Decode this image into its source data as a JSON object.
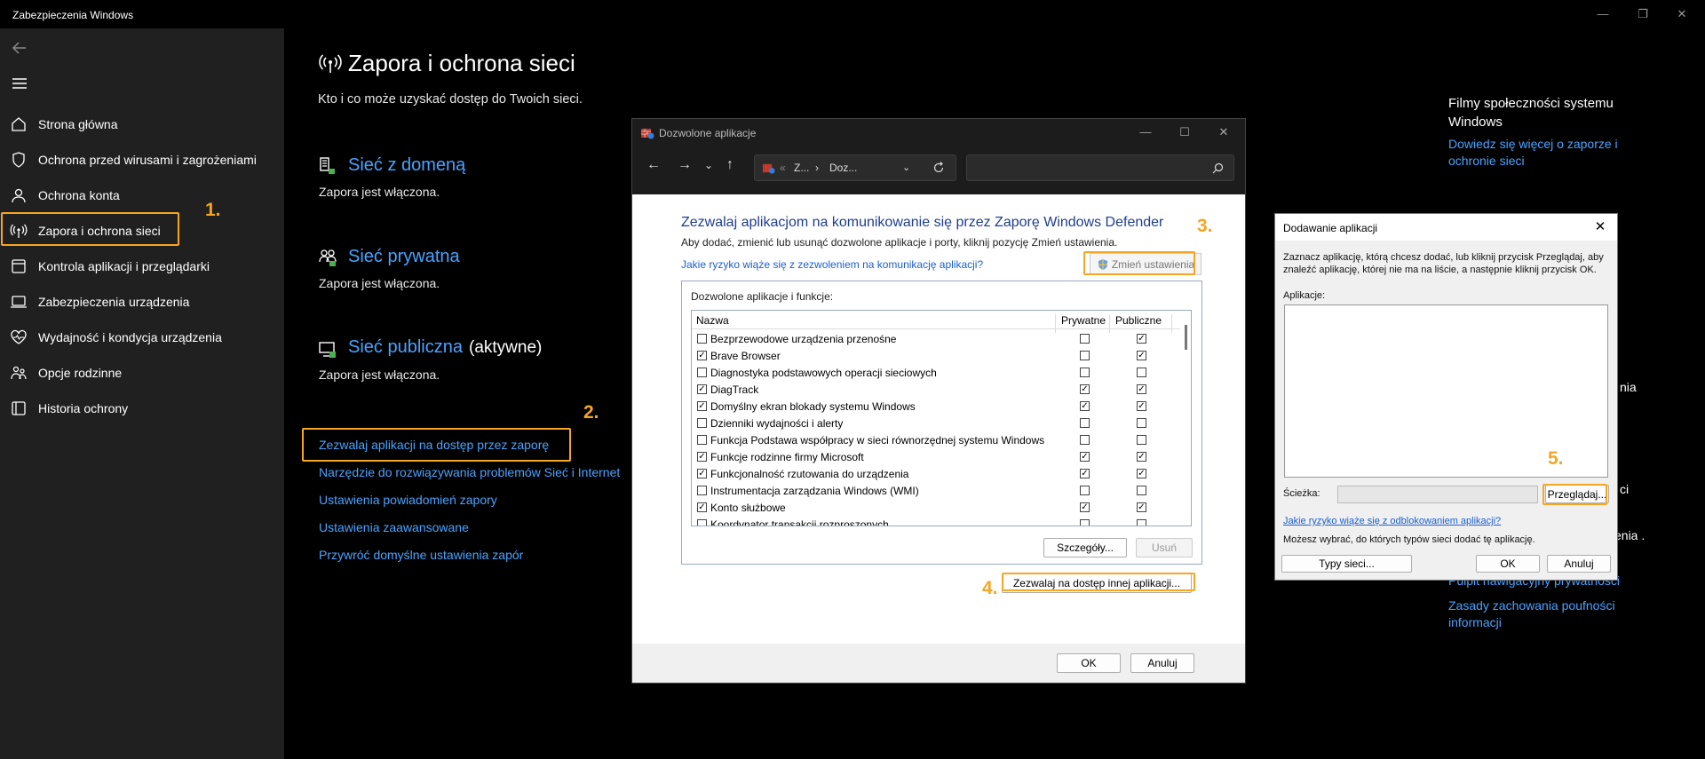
{
  "window": {
    "title": "Zabezpieczenia Windows",
    "controls": {
      "minimize": "—",
      "maximize": "❐",
      "close": "✕"
    }
  },
  "sidebar": {
    "items": [
      {
        "label": "Strona główna",
        "icon": "home-icon"
      },
      {
        "label": "Ochrona przed wirusami i zagrożeniami",
        "icon": "shield-icon"
      },
      {
        "label": "Ochrona konta",
        "icon": "person-icon"
      },
      {
        "label": "Zapora i ochrona sieci",
        "icon": "antenna-icon"
      },
      {
        "label": "Kontrola aplikacji i przeglądarki",
        "icon": "browser-window-icon"
      },
      {
        "label": "Zabezpieczenia urządzenia",
        "icon": "laptop-icon"
      },
      {
        "label": "Wydajność i kondycja urządzenia",
        "icon": "heart-pulse-icon"
      },
      {
        "label": "Opcje rodzinne",
        "icon": "family-icon"
      },
      {
        "label": "Historia ochrony",
        "icon": "history-icon"
      }
    ]
  },
  "steps": {
    "s1": "1.",
    "s2": "2.",
    "s3": "3.",
    "s4": "4.",
    "s5": "5."
  },
  "main": {
    "title": "Zapora i ochrona sieci",
    "subtitle": "Kto i co może uzyskać dostęp do Twoich sieci.",
    "networks": [
      {
        "title": "Sieć z domeną",
        "status": "Zapora jest włączona."
      },
      {
        "title": "Sieć prywatna",
        "status": "Zapora jest włączona."
      },
      {
        "title": "Sieć publiczna",
        "active": "(aktywne)",
        "status": "Zapora jest włączona."
      }
    ],
    "links": [
      "Zezwalaj aplikacji na dostęp przez zaporę",
      "Narzędzie do rozwiązywania problemów Sieć i Internet",
      "Ustawienia powiadomień zapory",
      "Ustawienia zaawansowane",
      "Przywróć domyślne ustawienia zapór"
    ]
  },
  "right": {
    "title": "Filmy społeczności systemu Windows",
    "link1": "Dowiedz się więcej o zaporze i ochronie sieci",
    "partial1": "nia",
    "partial2": "ci",
    "partial3": "enia .",
    "partial_link": "Pulpit nawigacyjny prywatności",
    "link2": "Zasady zachowania poufności informacji"
  },
  "allowed_dialog": {
    "title": "Dozwolone aplikacje",
    "address": {
      "chevrons": "«",
      "part1": "Z...",
      "sep": "›",
      "part2": "Doz..."
    },
    "heading": "Zezwalaj aplikacjom na komunikowanie się przez Zaporę Windows Defender",
    "description": "Aby dodać, zmienić lub usunąć dozwolone aplikacje i porty, kliknij pozycję Zmień ustawienia.",
    "risk_link": "Jakie ryzyko wiąże się z zezwoleniem na komunikację aplikacji?",
    "change_settings": "Zmień ustawienia",
    "group_label": "Dozwolone aplikacje i funkcje:",
    "columns": {
      "name": "Nazwa",
      "private": "Prywatne",
      "public": "Publiczne"
    },
    "rows": [
      {
        "name": "Bezprzewodowe urządzenia przenośne",
        "enabled": false,
        "private": false,
        "public": true
      },
      {
        "name": "Brave Browser",
        "enabled": true,
        "private": false,
        "public": true
      },
      {
        "name": "Diagnostyka podstawowych operacji sieciowych",
        "enabled": false,
        "private": false,
        "public": false
      },
      {
        "name": "DiagTrack",
        "enabled": true,
        "private": true,
        "public": true
      },
      {
        "name": "Domyślny ekran blokady systemu Windows",
        "enabled": true,
        "private": true,
        "public": true
      },
      {
        "name": "Dzienniki wydajności i alerty",
        "enabled": false,
        "private": false,
        "public": false
      },
      {
        "name": "Funkcja Podstawa współpracy w sieci równorzędnej systemu Windows",
        "enabled": false,
        "private": false,
        "public": false
      },
      {
        "name": "Funkcje rodzinne firmy Microsoft",
        "enabled": true,
        "private": true,
        "public": true
      },
      {
        "name": "Funkcjonalność rzutowania do urządzenia",
        "enabled": true,
        "private": true,
        "public": true
      },
      {
        "name": "Instrumentacja zarządzania Windows (WMI)",
        "enabled": false,
        "private": false,
        "public": false
      },
      {
        "name": "Konto służbowe",
        "enabled": true,
        "private": true,
        "public": true
      },
      {
        "name": "Koordynator transakcji rozproszonych",
        "enabled": false,
        "private": false,
        "public": false
      }
    ],
    "details_btn": "Szczegóły...",
    "remove_btn": "Usuń",
    "allow_other_btn": "Zezwalaj na dostęp innej aplikacji...",
    "ok": "OK",
    "cancel": "Anuluj"
  },
  "add_dialog": {
    "title": "Dodawanie aplikacji",
    "description": "Zaznacz aplikację, którą chcesz dodać, lub kliknij przycisk Przeglądaj, aby znaleźć aplikację, której nie ma na liście, a następnie kliknij przycisk OK.",
    "apps_label": "Aplikacje:",
    "path_label": "Ścieżka:",
    "browse_btn": "Przeglądaj...",
    "risk_link": "Jakie ryzyko wiąże się z odblokowaniem aplikacji?",
    "network_types_text": "Możesz wybrać, do których typów sieci dodać tę aplikację.",
    "network_types_btn": "Typy sieci...",
    "ok": "OK",
    "cancel": "Anuluj"
  },
  "colors": {
    "accent_link": "#4aa3ff",
    "highlight": "#f5a623",
    "sidebar_bg": "#202020"
  }
}
